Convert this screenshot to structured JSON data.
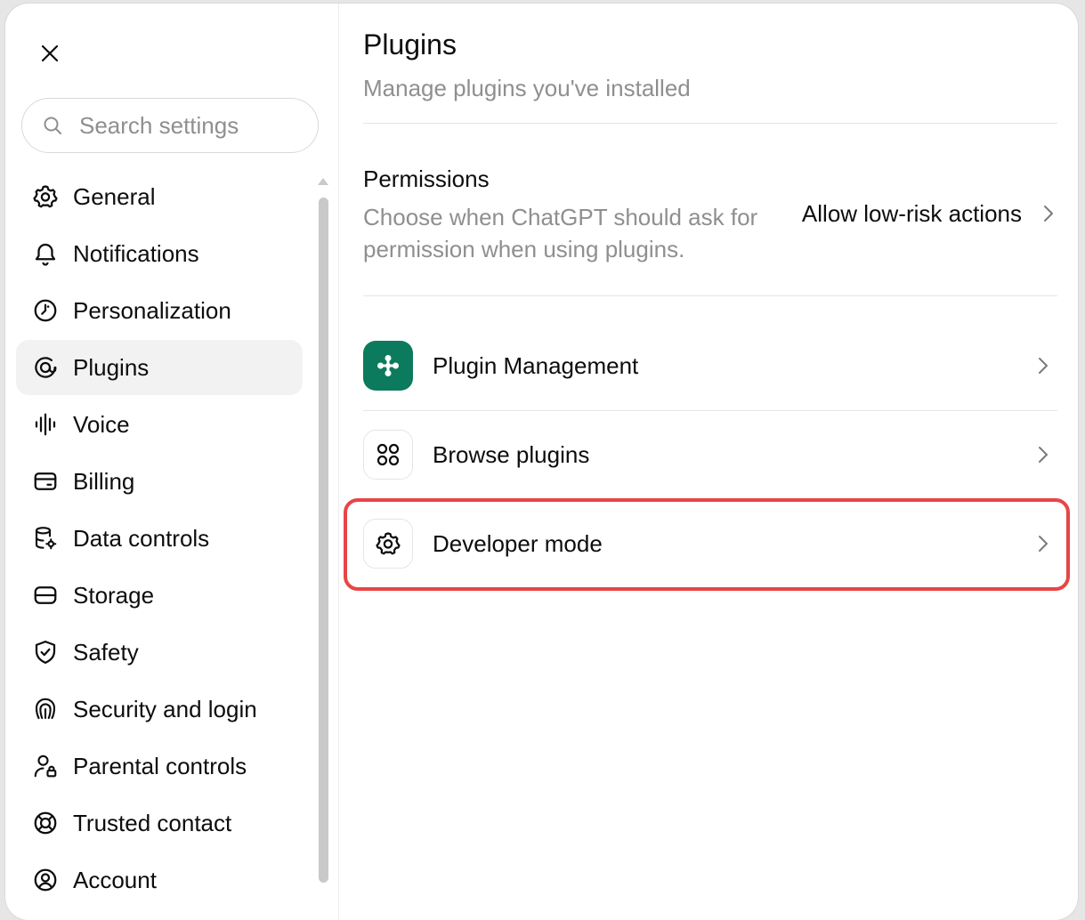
{
  "sidebar": {
    "search_placeholder": "Search settings",
    "items": [
      {
        "label": "General"
      },
      {
        "label": "Notifications"
      },
      {
        "label": "Personalization"
      },
      {
        "label": "Plugins"
      },
      {
        "label": "Voice"
      },
      {
        "label": "Billing"
      },
      {
        "label": "Data controls"
      },
      {
        "label": "Storage"
      },
      {
        "label": "Safety"
      },
      {
        "label": "Security and login"
      },
      {
        "label": "Parental controls"
      },
      {
        "label": "Trusted contact"
      },
      {
        "label": "Account"
      }
    ],
    "active_item": "Plugins"
  },
  "main": {
    "title": "Plugins",
    "subtitle": "Manage plugins you've installed",
    "permissions": {
      "title": "Permissions",
      "description": "Choose when ChatGPT should ask for permission when using plugins.",
      "value": "Allow low-risk actions"
    },
    "rows": [
      {
        "label": "Plugin Management"
      },
      {
        "label": "Browse plugins"
      },
      {
        "label": "Developer mode"
      }
    ]
  },
  "colors": {
    "highlight": "#e84545",
    "plugin_management_icon_bg": "#0c7a5c",
    "active_nav_bg": "#f2f2f2"
  },
  "icons": [
    "close-icon",
    "search-icon",
    "gear-icon",
    "bell-icon",
    "personalization-icon",
    "plugins-icon",
    "voice-icon",
    "billing-icon",
    "data-controls-icon",
    "storage-icon",
    "shield-icon",
    "security-icon",
    "parental-icon",
    "lifebuoy-icon",
    "account-icon",
    "chevron-right-icon",
    "plugin-management-icon",
    "grid-icon"
  ]
}
